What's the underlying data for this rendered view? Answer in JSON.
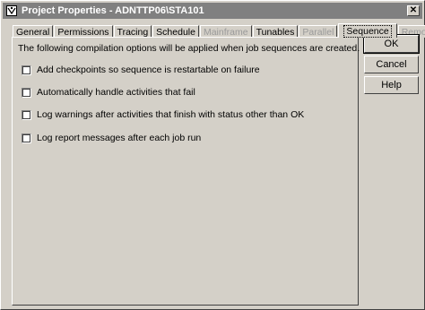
{
  "window": {
    "title": "Project Properties - ADNTTP06\\STA101"
  },
  "tabs": [
    {
      "label": "General",
      "state": "enabled"
    },
    {
      "label": "Permissions",
      "state": "enabled"
    },
    {
      "label": "Tracing",
      "state": "enabled"
    },
    {
      "label": "Schedule",
      "state": "enabled"
    },
    {
      "label": "Mainframe",
      "state": "disabled"
    },
    {
      "label": "Tunables",
      "state": "enabled"
    },
    {
      "label": "Parallel",
      "state": "disabled"
    },
    {
      "label": "Sequence",
      "state": "selected"
    },
    {
      "label": "Remote",
      "state": "disabled"
    }
  ],
  "panel": {
    "description": "The following compilation options will be applied when job sequences are created.",
    "options": [
      {
        "label": "Add checkpoints so sequence is restartable on failure",
        "checked": false
      },
      {
        "label": "Automatically handle activities that fail",
        "checked": false
      },
      {
        "label": "Log warnings after activities that finish with status other than OK",
        "checked": false
      },
      {
        "label": "Log report messages after each job run",
        "checked": false
      }
    ]
  },
  "buttons": {
    "ok": "OK",
    "cancel": "Cancel",
    "help": "Help"
  },
  "icons": {
    "app": "project-properties-icon",
    "close": "close-icon"
  }
}
